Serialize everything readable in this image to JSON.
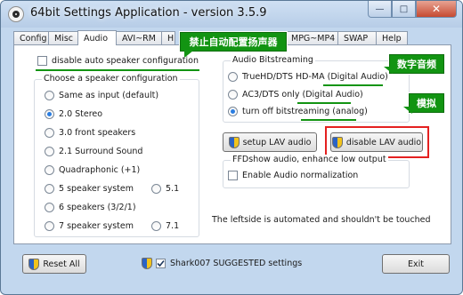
{
  "window": {
    "title": "64bit Settings Application - version 3.5.9",
    "controls": [
      "—",
      "□",
      "✕"
    ]
  },
  "tabs": [
    {
      "label": "Config",
      "active": false
    },
    {
      "label": "Misc",
      "active": false
    },
    {
      "label": "Audio",
      "active": true
    },
    {
      "label": "AVI~RM",
      "active": false
    },
    {
      "label": "H",
      "active": false
    },
    {
      "label": "MPG~MP4",
      "active": false
    },
    {
      "label": "SWAP",
      "active": false
    },
    {
      "label": "Help",
      "active": false
    }
  ],
  "audio": {
    "disable_speaker_config": {
      "label": "disable auto speaker configuration",
      "checked": false
    },
    "speaker_group": {
      "title": "Choose a speaker configuration",
      "options": [
        {
          "label": "Same as input (default)",
          "selected": false
        },
        {
          "label": "2.0 Stereo",
          "selected": true
        },
        {
          "label": "3.0 front speakers",
          "selected": false
        },
        {
          "label": "2.1 Surround Sound",
          "selected": false
        },
        {
          "label": "Quadraphonic (+1)",
          "selected": false
        },
        {
          "label": "5 speaker system",
          "selected": false
        },
        {
          "label": "6 speakers (3/2/1)",
          "selected": false
        },
        {
          "label": "7 speaker system",
          "selected": false
        }
      ],
      "extra_options": [
        {
          "label": "5.1",
          "selected": false
        },
        {
          "label": "7.1",
          "selected": false
        }
      ]
    },
    "bitstream_group": {
      "title": "Audio Bitstreaming",
      "options": [
        {
          "label": "TrueHD/DTS HD-MA (Digital Audio)",
          "selected": false
        },
        {
          "label": "AC3/DTS only (Digital Audio)",
          "selected": false
        },
        {
          "label": "turn off bitstreaming (analog)",
          "selected": true
        }
      ]
    },
    "setup_lav_label": "setup LAV audio",
    "disable_lav_label": "disable LAV audio",
    "ffdshow_group": {
      "title": "FFDshow audio, enhance low output",
      "normalization": {
        "label": "Enable Audio normalization",
        "checked": false
      }
    },
    "footnote": "The leftside is automated and shouldn't be touched"
  },
  "bottom": {
    "reset_label": "Reset All",
    "suggested": {
      "label": "Shark007 SUGGESTED settings",
      "checked": true
    },
    "exit_label": "Exit"
  },
  "annotations": {
    "disable_speaker": "禁止自动配置扬声器",
    "digital_audio": "数字音频",
    "analog": "模拟"
  },
  "colors": {
    "annotation_green": "#129412",
    "highlight_red": "#e42020",
    "radio_accent": "#2a7de1"
  }
}
